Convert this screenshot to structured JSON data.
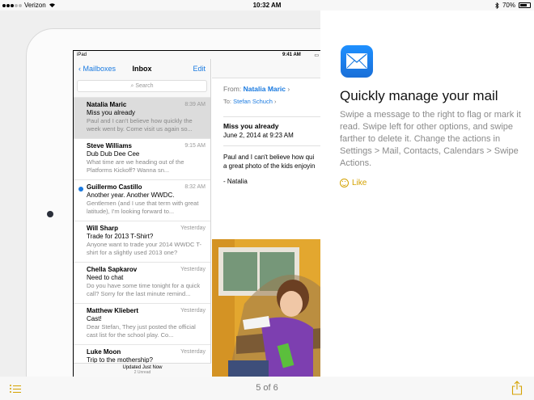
{
  "status_bar": {
    "carrier": "Verizon",
    "time": "10:32 AM",
    "battery": "70%"
  },
  "inner_status": {
    "device": "iPad",
    "time": "9:41 AM"
  },
  "mail_list": {
    "back_label": "Mailboxes",
    "title": "Inbox",
    "edit_label": "Edit",
    "search_placeholder": "Search",
    "items": [
      {
        "from": "Natalia Maric",
        "time": "8:39 AM",
        "subject": "Miss you already",
        "preview": "Paul and I can't believe how quickly the week went by. Come visit us again so...",
        "unread": false,
        "selected": true
      },
      {
        "from": "Steve Williams",
        "time": "9:15 AM",
        "subject": "Dub Dub Dee Cee",
        "preview": "What time are we heading out of the Platforms Kickoff? Wanna sn...",
        "unread": false,
        "selected": false
      },
      {
        "from": "Guillermo Castillo",
        "time": "8:32 AM",
        "subject": "Another year. Another WWDC.",
        "preview": "Gentlemen (and I use that term with great latitude), I'm looking forward to...",
        "unread": true,
        "selected": false
      },
      {
        "from": "Will Sharp",
        "time": "Yesterday",
        "subject": "Trade for 2013 T-Shirt?",
        "preview": "Anyone want to trade your 2014 WWDC T-shirt for a slightly used 2013 one?",
        "unread": false,
        "selected": false
      },
      {
        "from": "Chella Sapkarov",
        "time": "Yesterday",
        "subject": "Need to chat",
        "preview": "Do you have some time tonight for a quick call? Sorry for the last minute remind...",
        "unread": false,
        "selected": false
      },
      {
        "from": "Matthew Kliebert",
        "time": "Yesterday",
        "subject": "Cast!",
        "preview": "Dear Stefan, They just posted the official cast list for the school play. Co...",
        "unread": false,
        "selected": false
      },
      {
        "from": "Luke Moon",
        "time": "Yesterday",
        "subject": "Trip to the mothership?",
        "preview": "",
        "unread": false,
        "selected": false
      }
    ],
    "footer_updated": "Updated Just Now",
    "footer_unread": "2 Unread"
  },
  "mail_detail": {
    "from_label": "From:",
    "from_name": "Natalia Maric",
    "to_label": "To:",
    "to_name": "Stefan Schuch",
    "subject": "Miss you already",
    "date": "June 2, 2014 at 9:23 AM",
    "body_line1": "Paul and I can't believe how qui",
    "body_line2": "a great photo of the kids enjoyin",
    "signature": "- Natalia"
  },
  "tip": {
    "icon": "mail-app-icon",
    "headline": "Quickly manage your mail",
    "description": "Swipe a message to the right to flag or mark it read. Swipe left for other options, and swipe farther to delete it. Change the actions in Settings > Mail, Contacts, Calendars > Swipe Actions.",
    "like_label": "Like"
  },
  "bottom_bar": {
    "page_indicator": "5 of 6"
  },
  "colors": {
    "accent": "#d4a200",
    "mail_blue": "#1a7ae0"
  }
}
